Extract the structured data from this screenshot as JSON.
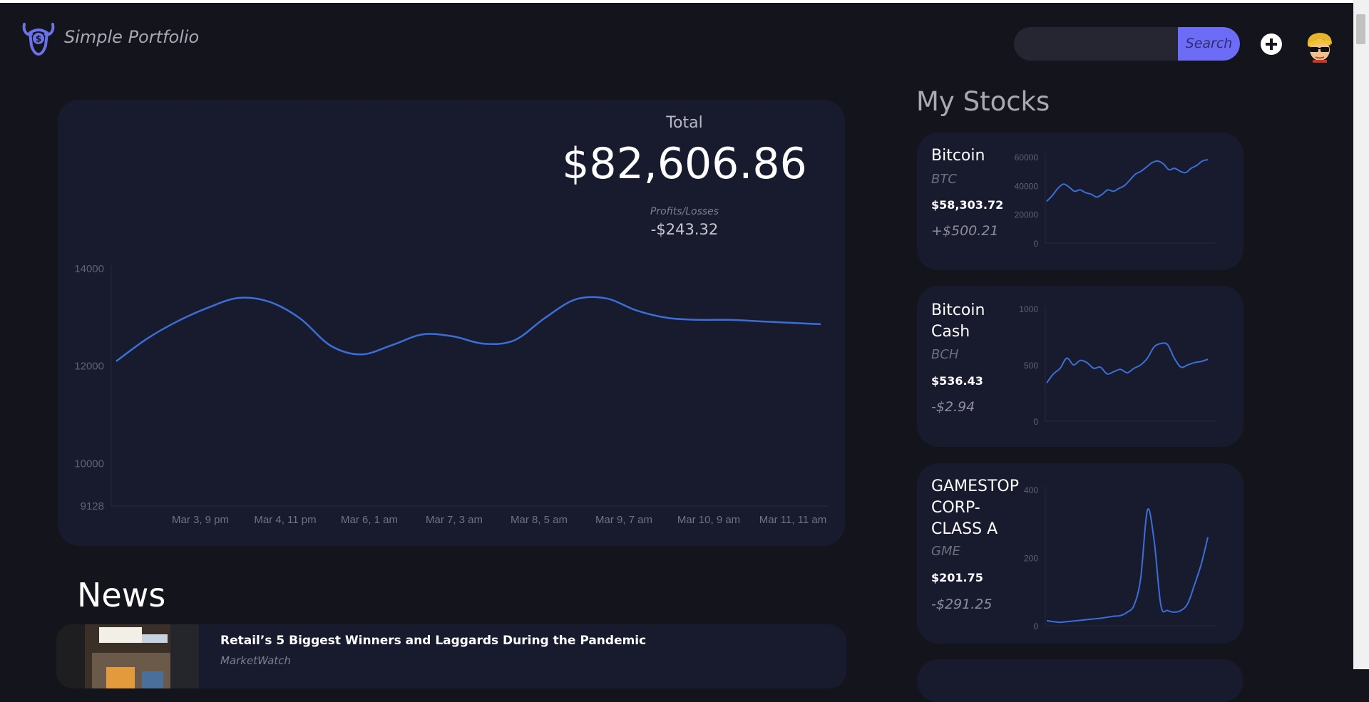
{
  "app": {
    "name": "Simple Portfolio"
  },
  "header": {
    "search_value": "",
    "search_button": "Search",
    "add_icon": "plus-circle-icon",
    "avatar_icon": "avatar-face-icon"
  },
  "total": {
    "label": "Total",
    "value": "$82,606.86",
    "pl_label": "Profits/Losses",
    "pl_value": "-$243.32"
  },
  "chart_data": [
    {
      "type": "line",
      "title": "",
      "x": [
        "Mar 3, 9 pm",
        "Mar 4, 11 pm",
        "Mar 6, 1 am",
        "Mar 7, 3 am",
        "Mar 8, 5 am",
        "Mar 9, 7 am",
        "Mar 10, 9 am",
        "Mar 11, 11 am"
      ],
      "yticks": [
        9128,
        10000,
        12000,
        14000
      ],
      "ylim": [
        9128,
        14000
      ],
      "series": [
        {
          "values": [
            12100,
            12560,
            12920,
            13200,
            13400,
            13320,
            12980,
            12420,
            12240,
            12430,
            12650,
            12610,
            12460,
            12530,
            12990,
            13370,
            13390,
            13140,
            12990,
            12950,
            12950,
            12920,
            12890,
            12860
          ]
        }
      ],
      "color": "#3b6fd6"
    },
    {
      "type": "line",
      "title": "",
      "yticks": [
        0,
        20000,
        40000,
        60000
      ],
      "ylim": [
        0,
        60000
      ],
      "series": [
        {
          "values": [
            29000,
            33000,
            38000,
            41000,
            39000,
            36000,
            37000,
            35000,
            34000,
            32000,
            34000,
            37000,
            36000,
            38000,
            40000,
            44000,
            48000,
            50000,
            53000,
            56000,
            57000,
            55000,
            51000,
            52000,
            50000,
            49000,
            52000,
            54000,
            57000,
            58000
          ]
        }
      ],
      "color": "#3b6fd6"
    },
    {
      "type": "line",
      "title": "",
      "yticks": [
        0,
        500,
        1000
      ],
      "ylim": [
        0,
        1000
      ],
      "series": [
        {
          "values": [
            340,
            420,
            470,
            560,
            500,
            540,
            520,
            470,
            480,
            420,
            440,
            460,
            430,
            470,
            500,
            560,
            660,
            690,
            680,
            560,
            480,
            500,
            520,
            530,
            550
          ]
        }
      ],
      "color": "#3b6fd6"
    },
    {
      "type": "line",
      "title": "",
      "yticks": [
        0,
        200,
        400
      ],
      "ylim": [
        0,
        400
      ],
      "series": [
        {
          "values": [
            15,
            12,
            10,
            12,
            14,
            16,
            18,
            20,
            22,
            25,
            28,
            30,
            40,
            60,
            140,
            340,
            250,
            60,
            45,
            40,
            45,
            65,
            120,
            180,
            260
          ]
        }
      ],
      "color": "#3b6fd6"
    }
  ],
  "my_stocks": {
    "title": "My Stocks",
    "items": [
      {
        "name": "Bitcoin",
        "ticker": "BTC",
        "price": "$58,303.72",
        "change": "+$500.21"
      },
      {
        "name": "Bitcoin Cash",
        "ticker": "BCH",
        "price": "$536.43",
        "change": "-$2.94"
      },
      {
        "name": "GAMESTOP CORP-CLASS A",
        "ticker": "GME",
        "price": "$201.75",
        "change": "-$291.25"
      }
    ]
  },
  "news": {
    "title": "News",
    "items": [
      {
        "headline": "Retail’s 5 Biggest Winners and Laggards During the Pandemic",
        "source": "MarketWatch"
      }
    ]
  }
}
